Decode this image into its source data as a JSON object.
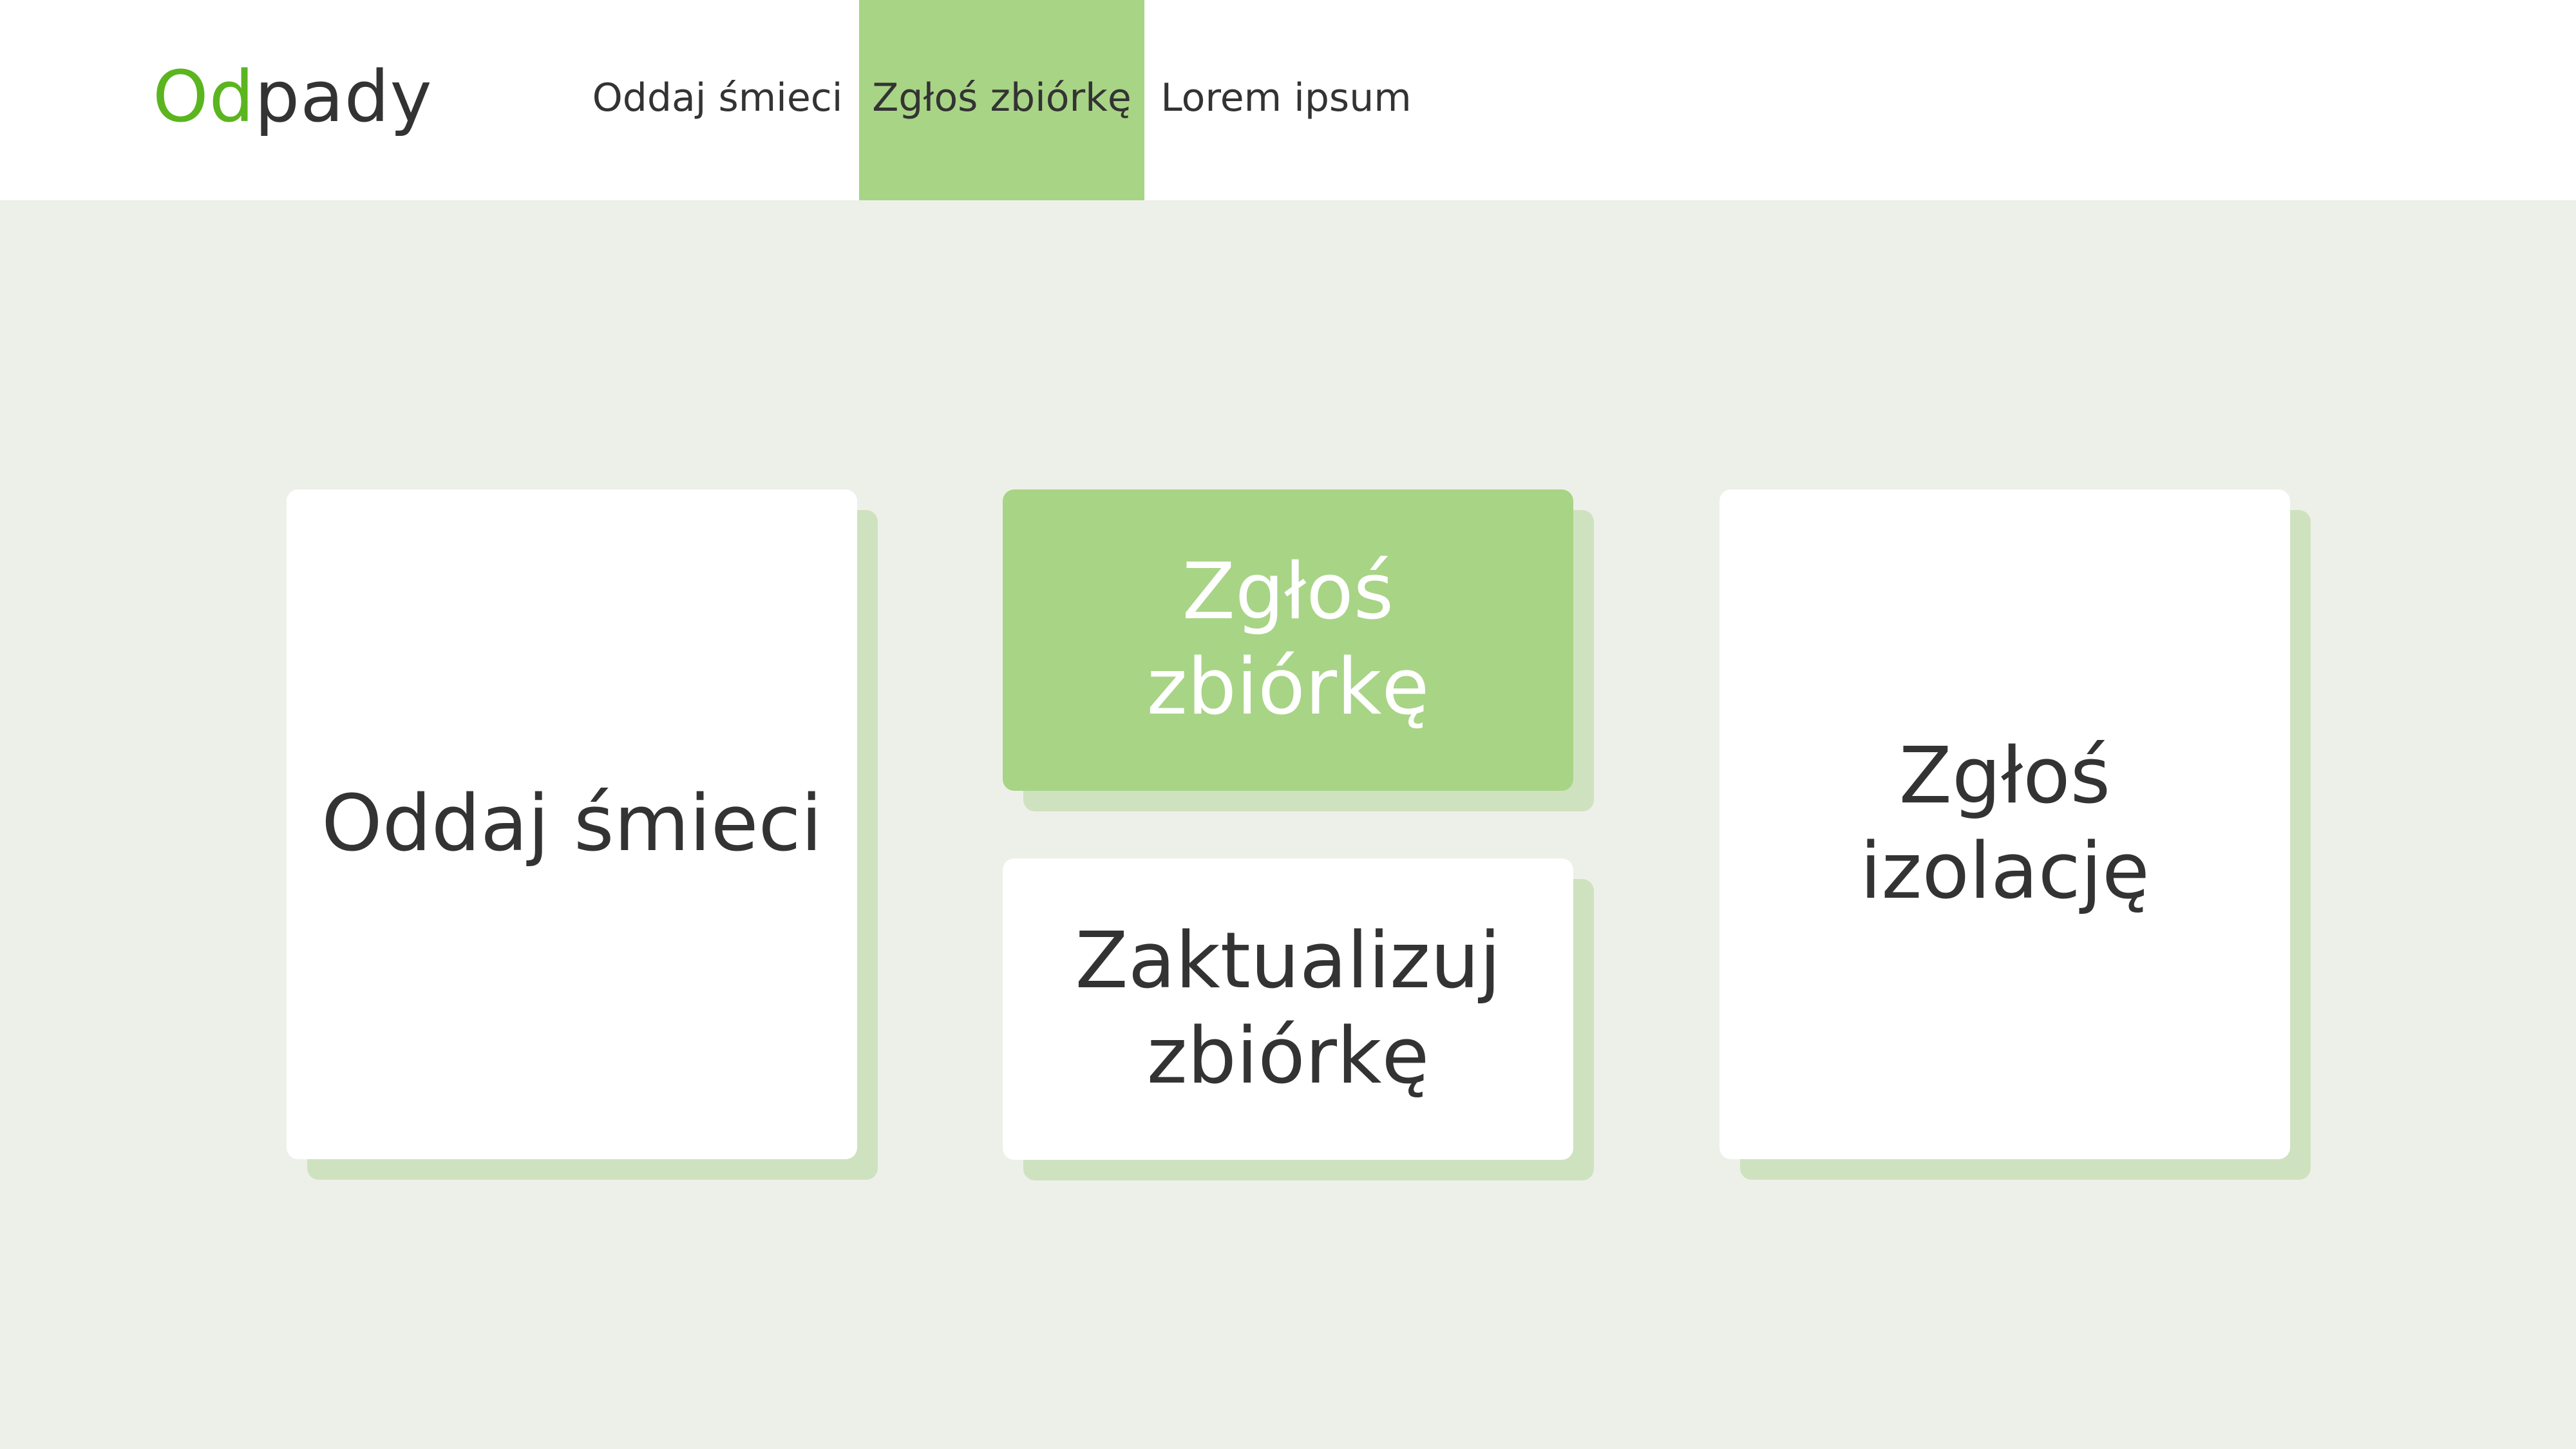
{
  "header": {
    "logo": {
      "accent": "Od",
      "rest": "pady"
    },
    "nav": [
      {
        "label": "Oddaj śmieci",
        "active": false
      },
      {
        "label": "Zgłoś zbiórkę",
        "active": true
      },
      {
        "label": "Lorem ipsum",
        "active": false
      }
    ]
  },
  "tiles": {
    "oddaj": {
      "label": "Oddaj śmieci"
    },
    "zglos_zbiorke": {
      "label": "Zgłoś zbiórkę"
    },
    "zaktualizuj": {
      "label": "Zaktualizuj zbiórkę"
    },
    "zglos_izolacje": {
      "label": "Zgłoś izolację"
    }
  },
  "colors": {
    "accent_green": "#5bb51f",
    "highlight_green": "#a8d486",
    "shadow_green": "#cfe2c0",
    "background": "#edf0e8",
    "text": "#333333"
  }
}
